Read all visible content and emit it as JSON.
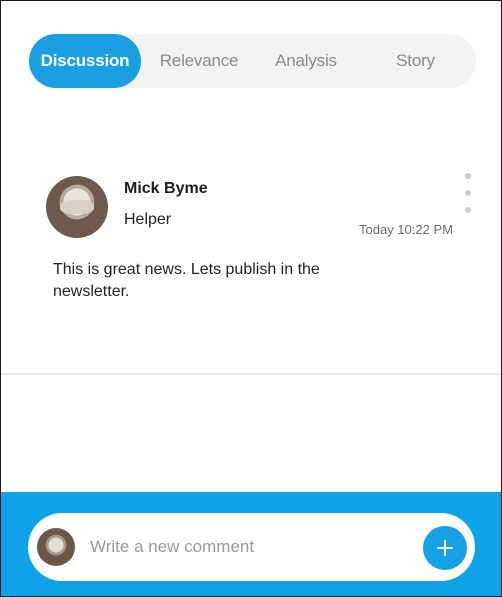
{
  "tabs": [
    {
      "label": "Discussion",
      "active": true
    },
    {
      "label": "Relevance",
      "active": false
    },
    {
      "label": "Analysis",
      "active": false
    },
    {
      "label": "Story",
      "active": false
    }
  ],
  "comment": {
    "author": "Mick Byme",
    "role": "Helper",
    "time": "Today 10:22 PM",
    "body": "This is great news. Lets publish in the newsletter.",
    "more_icon": "more-vertical-icon"
  },
  "composer": {
    "placeholder": "Write a new comment",
    "add_icon": "plus-icon"
  },
  "colors": {
    "accent": "#1aa0e2",
    "bottom_bar": "#0ea2e6"
  }
}
